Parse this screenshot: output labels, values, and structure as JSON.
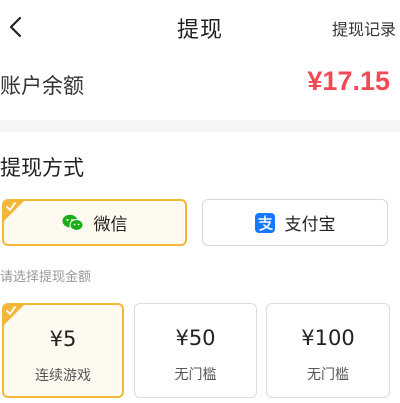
{
  "header": {
    "title": "提现",
    "records_link": "提现记录"
  },
  "balance": {
    "label": "账户余额",
    "value": "¥17.15"
  },
  "withdraw_method": {
    "section_title": "提现方式",
    "options": [
      {
        "label": "微信",
        "icon": "wechat-icon",
        "selected": true
      },
      {
        "label": "支付宝",
        "icon": "alipay-icon",
        "selected": false
      }
    ]
  },
  "amount": {
    "hint": "请选择提现金额",
    "options": [
      {
        "value": "¥5",
        "sub": "连续游戏",
        "selected": true
      },
      {
        "value": "¥50",
        "sub": "无门槛",
        "selected": false
      },
      {
        "value": "¥100",
        "sub": "无门槛",
        "selected": false
      }
    ]
  },
  "colors": {
    "accent": "#f3b73a",
    "balance_red": "#f04a54",
    "wechat_green": "#1aad19",
    "alipay_blue": "#1677ff",
    "hint_gray": "#999999"
  }
}
